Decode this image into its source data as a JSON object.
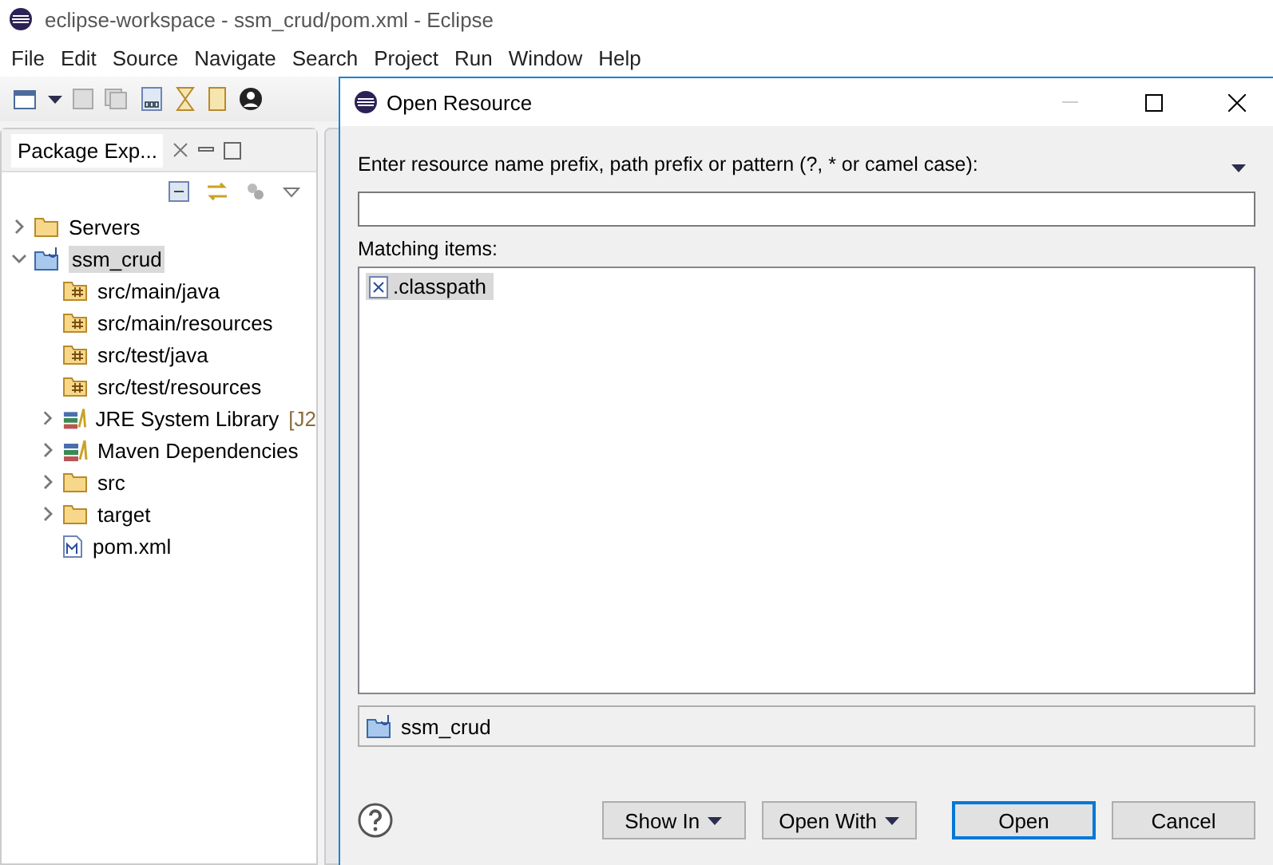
{
  "window": {
    "title": "eclipse-workspace - ssm_crud/pom.xml - Eclipse"
  },
  "menu": [
    "File",
    "Edit",
    "Source",
    "Navigate",
    "Search",
    "Project",
    "Run",
    "Window",
    "Help"
  ],
  "package_explorer": {
    "tab": "Package Exp...",
    "tree": [
      {
        "label": "Servers",
        "kind": "folder",
        "expanded": false,
        "selected": false
      },
      {
        "label": "ssm_crud",
        "kind": "project",
        "expanded": true,
        "selected": true,
        "children": [
          {
            "label": "src/main/java",
            "kind": "package",
            "selected": false
          },
          {
            "label": "src/main/resources",
            "kind": "package",
            "selected": false
          },
          {
            "label": "src/test/java",
            "kind": "package",
            "selected": false
          },
          {
            "label": "src/test/resources",
            "kind": "package",
            "selected": false
          },
          {
            "label": "JRE System Library",
            "decoration": "[J2",
            "kind": "library",
            "expanded": false,
            "selected": false
          },
          {
            "label": "Maven Dependencies",
            "kind": "library",
            "expanded": false,
            "selected": false
          },
          {
            "label": "src",
            "kind": "folder",
            "expanded": false,
            "selected": false
          },
          {
            "label": "target",
            "kind": "folder",
            "expanded": false,
            "selected": false
          },
          {
            "label": "pom.xml",
            "kind": "maven",
            "selected": false
          }
        ]
      }
    ]
  },
  "dialog": {
    "title": "Open Resource",
    "prompt": "Enter resource name prefix, path prefix or pattern (?, * or camel case):",
    "matching_label": "Matching items:",
    "items": [
      {
        "label": ".classpath",
        "selected": true
      }
    ],
    "location": "ssm_crud",
    "buttons": [
      {
        "label": "Show In",
        "kind": "menu"
      },
      {
        "label": "Open With",
        "kind": "menu"
      },
      {
        "label": "Open",
        "kind": "default"
      },
      {
        "label": "Cancel",
        "kind": "plain"
      }
    ]
  }
}
